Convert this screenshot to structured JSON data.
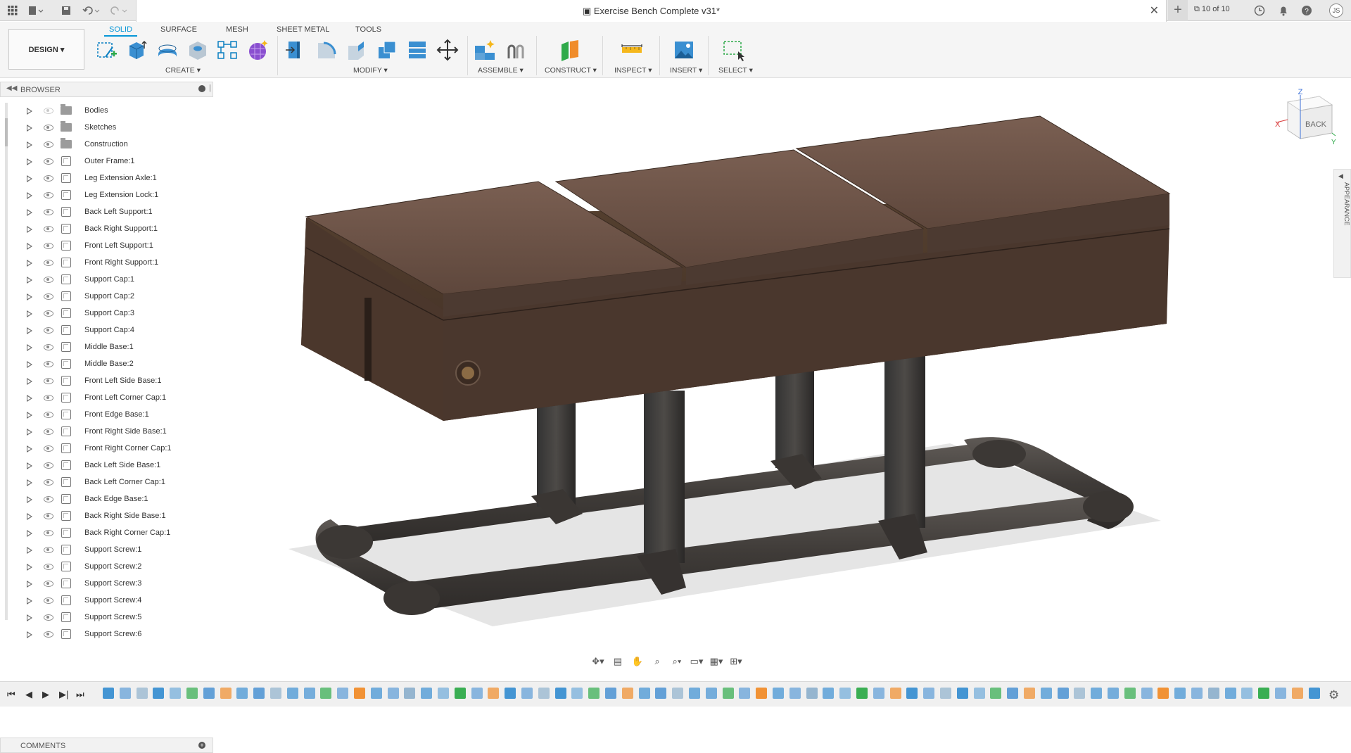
{
  "app": {
    "title": "Exercise Bench Complete v31*",
    "versions": "10 of 10",
    "user_initials": "JS"
  },
  "workspace": {
    "label": "DESIGN ▾"
  },
  "tabs": [
    {
      "label": "SOLID",
      "active": true
    },
    {
      "label": "SURFACE",
      "active": false
    },
    {
      "label": "MESH",
      "active": false
    },
    {
      "label": "SHEET METAL",
      "active": false
    },
    {
      "label": "TOOLS",
      "active": false
    }
  ],
  "groups": [
    "CREATE ▾",
    "MODIFY ▾",
    "ASSEMBLE ▾",
    "CONSTRUCT ▾",
    "INSPECT ▾",
    "INSERT ▾",
    "SELECT ▾"
  ],
  "tools": [
    {
      "name": "create-sketch-icon"
    },
    {
      "name": "extrude-icon"
    },
    {
      "name": "revolve-icon"
    },
    {
      "name": "hole-icon"
    },
    {
      "name": "rectangular-pattern-icon"
    },
    {
      "name": "create-form-icon"
    },
    {
      "name": "press-pull-icon"
    },
    {
      "name": "fillet-icon"
    },
    {
      "name": "chamfer-icon"
    },
    {
      "name": "combine-icon"
    },
    {
      "name": "align-icon"
    },
    {
      "name": "move-icon"
    },
    {
      "name": "new-component-icon"
    },
    {
      "name": "joint-icon"
    },
    {
      "name": "construct-plane-icon"
    },
    {
      "name": "measure-icon"
    },
    {
      "name": "insert-image-icon"
    },
    {
      "name": "select-icon"
    }
  ],
  "browser": {
    "title": "BROWSER",
    "items": [
      {
        "label": "Bodies",
        "type": "folder",
        "visible": false
      },
      {
        "label": "Sketches",
        "type": "folder",
        "visible": true
      },
      {
        "label": "Construction",
        "type": "folder",
        "visible": true
      },
      {
        "label": "Outer Frame:1",
        "type": "component",
        "visible": true
      },
      {
        "label": "Leg Extension Axle:1",
        "type": "component",
        "visible": true
      },
      {
        "label": "Leg Extension Lock:1",
        "type": "component",
        "visible": true
      },
      {
        "label": "Back Left Support:1",
        "type": "component",
        "visible": true
      },
      {
        "label": "Back Right Support:1",
        "type": "component",
        "visible": true
      },
      {
        "label": "Front Left Support:1",
        "type": "component",
        "visible": true
      },
      {
        "label": "Front Right Support:1",
        "type": "component",
        "visible": true
      },
      {
        "label": "Support Cap:1",
        "type": "component",
        "visible": true
      },
      {
        "label": "Support Cap:2",
        "type": "component",
        "visible": true
      },
      {
        "label": "Support Cap:3",
        "type": "component",
        "visible": true
      },
      {
        "label": "Support Cap:4",
        "type": "component",
        "visible": true
      },
      {
        "label": "Middle Base:1",
        "type": "component",
        "visible": true
      },
      {
        "label": "Middle Base:2",
        "type": "component",
        "visible": true
      },
      {
        "label": "Front Left Side Base:1",
        "type": "component",
        "visible": true
      },
      {
        "label": "Front Left Corner Cap:1",
        "type": "component",
        "visible": true
      },
      {
        "label": "Front Edge Base:1",
        "type": "component",
        "visible": true
      },
      {
        "label": "Front Right Side Base:1",
        "type": "component",
        "visible": true
      },
      {
        "label": "Front Right Corner Cap:1",
        "type": "component",
        "visible": true
      },
      {
        "label": "Back Left Side Base:1",
        "type": "component",
        "visible": true
      },
      {
        "label": "Back Left Corner Cap:1",
        "type": "component",
        "visible": true
      },
      {
        "label": "Back Edge Base:1",
        "type": "component",
        "visible": true
      },
      {
        "label": "Back Right Side Base:1",
        "type": "component",
        "visible": true
      },
      {
        "label": "Back Right Corner Cap:1",
        "type": "component",
        "visible": true
      },
      {
        "label": "Support Screw:1",
        "type": "component",
        "visible": true
      },
      {
        "label": "Support Screw:2",
        "type": "component",
        "visible": true
      },
      {
        "label": "Support Screw:3",
        "type": "component",
        "visible": true
      },
      {
        "label": "Support Screw:4",
        "type": "component",
        "visible": true
      },
      {
        "label": "Support Screw:5",
        "type": "component",
        "visible": true
      },
      {
        "label": "Support Screw:6",
        "type": "component",
        "visible": true
      }
    ]
  },
  "comments": {
    "title": "COMMENTS"
  },
  "viewcube": {
    "face": "BACK",
    "axis_x": "X",
    "axis_z": "Z",
    "axis_y": "Y"
  },
  "appearance_panel": {
    "label": "APPEARANCE"
  },
  "colors": {
    "accent": "#0696d7",
    "bench_top": "#6b5245",
    "bench_body": "#4f3a30",
    "frame": "#4a4542"
  }
}
